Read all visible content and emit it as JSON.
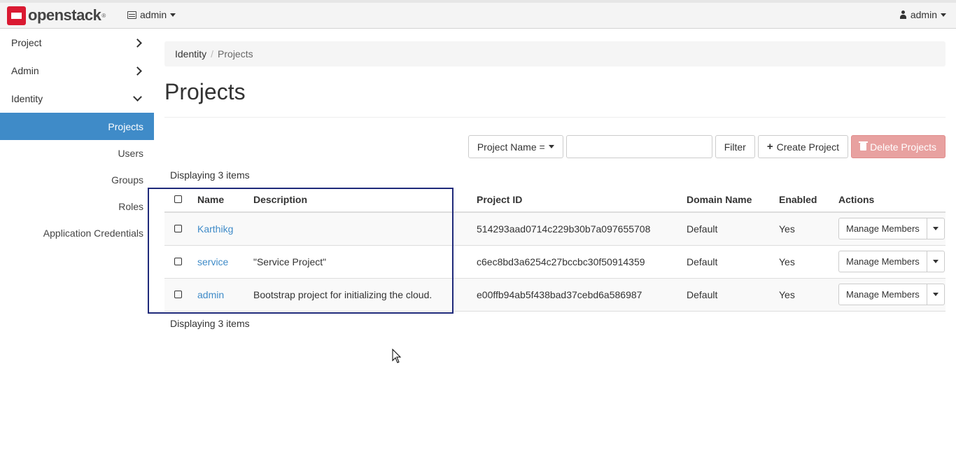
{
  "brand": {
    "name": "openstack",
    "reg": "®"
  },
  "topbar": {
    "project_label": "admin",
    "user_label": "admin"
  },
  "sidebar": {
    "items": [
      {
        "label": "Project"
      },
      {
        "label": "Admin"
      },
      {
        "label": "Identity"
      }
    ],
    "subitems": [
      {
        "label": "Projects",
        "active": true
      },
      {
        "label": "Users"
      },
      {
        "label": "Groups"
      },
      {
        "label": "Roles"
      },
      {
        "label": "Application Credentials"
      }
    ]
  },
  "breadcrumb": {
    "root": "Identity",
    "sep": "/",
    "current": "Projects"
  },
  "page": {
    "title": "Projects"
  },
  "toolbar": {
    "filter_select": "Project Name =",
    "filter_value": "",
    "filter_button": "Filter",
    "create_button": "Create Project",
    "delete_button": "Delete Projects"
  },
  "table": {
    "count_top": "Displaying 3 items",
    "count_bottom": "Displaying 3 items",
    "headers": {
      "name": "Name",
      "description": "Description",
      "project_id": "Project ID",
      "domain": "Domain Name",
      "enabled": "Enabled",
      "actions": "Actions"
    },
    "rows": [
      {
        "name": "Karthikg",
        "description": "",
        "project_id": "514293aad0714c229b30b7a097655708",
        "domain": "Default",
        "enabled": "Yes",
        "action": "Manage Members"
      },
      {
        "name": "service",
        "description": "\"Service Project\"",
        "project_id": "c6ec8bd3a6254c27bccbc30f50914359",
        "domain": "Default",
        "enabled": "Yes",
        "action": "Manage Members"
      },
      {
        "name": "admin",
        "description": "Bootstrap project for initializing the cloud.",
        "project_id": "e00ffb94ab5f438bad37cebd6a586987",
        "domain": "Default",
        "enabled": "Yes",
        "action": "Manage Members"
      }
    ]
  },
  "colors": {
    "accent": "#3f8bc8",
    "brand_red": "#da1a32",
    "danger_light": "#e8a1a0",
    "highlight": "#1f2a7a"
  }
}
